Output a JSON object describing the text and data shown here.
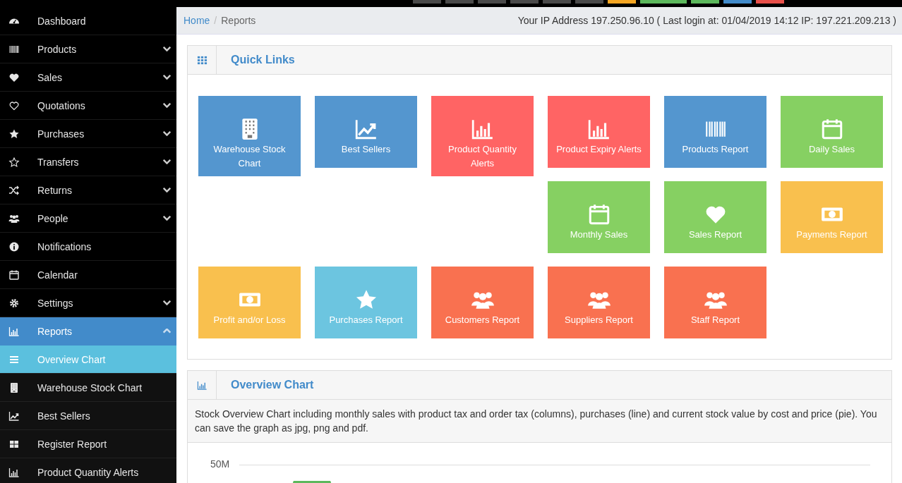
{
  "top_bar_buttons": [
    {
      "color": "#4a4a4a"
    },
    {
      "color": "#4a4a4a"
    },
    {
      "color": "#4a4a4a"
    },
    {
      "color": "#4a4a4a"
    },
    {
      "color": "#4a4a4a"
    },
    {
      "color": "#4a4a4a"
    },
    {
      "color": "#f5a623"
    },
    {
      "color": "#5cb85c"
    },
    {
      "color": "#5cb85c"
    },
    {
      "color": "#428bca"
    },
    {
      "color": "#e8504a"
    }
  ],
  "sidebar": {
    "items": [
      {
        "label": "Dashboard",
        "expandable": false,
        "selected": false
      },
      {
        "label": "Products",
        "expandable": true,
        "expanded": false,
        "selected": false
      },
      {
        "label": "Sales",
        "expandable": true,
        "expanded": false,
        "selected": false
      },
      {
        "label": "Quotations",
        "expandable": true,
        "expanded": false,
        "selected": false
      },
      {
        "label": "Purchases",
        "expandable": true,
        "expanded": false,
        "selected": false
      },
      {
        "label": "Transfers",
        "expandable": true,
        "expanded": false,
        "selected": false
      },
      {
        "label": "Returns",
        "expandable": true,
        "expanded": false,
        "selected": false
      },
      {
        "label": "People",
        "expandable": true,
        "expanded": false,
        "selected": false
      },
      {
        "label": "Notifications",
        "expandable": false,
        "selected": false
      },
      {
        "label": "Calendar",
        "expandable": false,
        "selected": false
      },
      {
        "label": "Settings",
        "expandable": true,
        "expanded": false,
        "selected": false
      },
      {
        "label": "Reports",
        "expandable": true,
        "expanded": true,
        "selected": true,
        "children": [
          {
            "label": "Overview Chart",
            "selected": true
          },
          {
            "label": "Warehouse Stock Chart",
            "selected": false
          },
          {
            "label": "Best Sellers",
            "selected": false
          },
          {
            "label": "Register Report",
            "selected": false
          },
          {
            "label": "Product Quantity Alerts",
            "selected": false
          }
        ]
      }
    ]
  },
  "breadcrumb": {
    "items": [
      "Home",
      "Reports"
    ],
    "separator": "/",
    "login_info": "Your IP Address 197.250.96.10 ( Last login at: 01/04/2019 14:12 IP: 197.221.209.213 )"
  },
  "quick_links": {
    "title": "Quick Links",
    "tiles": [
      {
        "label": "Warehouse Stock Chart",
        "color": "#5496cf"
      },
      {
        "label": "Best Sellers",
        "color": "#5496cf"
      },
      {
        "label": "Product Quantity Alerts",
        "color": "#ff6464"
      },
      {
        "label": "Product Expiry Alerts",
        "color": "#ff6464"
      },
      {
        "label": "Products Report",
        "color": "#5496cf"
      },
      {
        "label": "Daily Sales",
        "color": "#86d062"
      },
      {
        "label": "Monthly Sales",
        "color": "#86d062"
      },
      {
        "label": "Sales Report",
        "color": "#86d062"
      },
      {
        "label": "Payments Report",
        "color": "#f9c04e"
      },
      {
        "label": "Profit and/or Loss",
        "color": "#f9c04e"
      },
      {
        "label": "Purchases Report",
        "color": "#6cc5e0"
      },
      {
        "label": "Customers Report",
        "color": "#f97150"
      },
      {
        "label": "Suppliers Report",
        "color": "#f97150"
      },
      {
        "label": "Staff Report",
        "color": "#f97150"
      }
    ]
  },
  "overview_chart": {
    "title": "Overview Chart",
    "description": "Stock Overview Chart including monthly sales with product tax and order tax (columns), purchases (line) and current stock value by cost and price (pie). You can save the graph as jpg, png and pdf.",
    "y_tick": "50M"
  }
}
